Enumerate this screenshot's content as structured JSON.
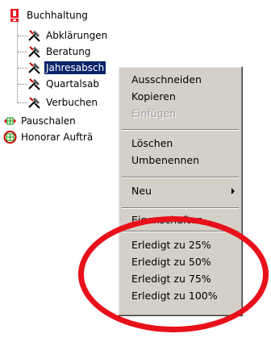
{
  "tree": {
    "root": {
      "label": "Buchhaltung",
      "icon": "exclamation-icon"
    },
    "children": [
      {
        "label": "Abklärungen",
        "icon": "tools-icon"
      },
      {
        "label": "Beratung",
        "icon": "tools-icon"
      },
      {
        "label": "Jahresabsch",
        "icon": "tools-icon",
        "selected": true
      },
      {
        "label": "Quartalsab",
        "icon": "tools-icon"
      },
      {
        "label": "Verbuchen",
        "icon": "tools-icon"
      }
    ],
    "siblings": [
      {
        "label": "Pauschalen",
        "icon": "grid-arrows-icon"
      },
      {
        "label": "Honorar Aufträ",
        "icon": "grid-cycle-icon"
      }
    ]
  },
  "context_menu": {
    "items": [
      {
        "label": "Ausschneiden"
      },
      {
        "label": "Kopieren"
      },
      {
        "label": "Einfügen",
        "disabled": true
      },
      {
        "label": "Löschen"
      },
      {
        "label": "Umbenennen"
      },
      {
        "label": "Neu",
        "submenu": true,
        "icon": "submenu-arrow-icon"
      },
      {
        "label": "Eigenschaften",
        "partially_hidden": true
      },
      {
        "label": "Erledigt zu 25%"
      },
      {
        "label": "Erledigt zu 50%"
      },
      {
        "label": "Erledigt zu 75%"
      },
      {
        "label": "Erledigt zu 100%"
      }
    ]
  },
  "colors": {
    "selection": "#0a246a",
    "menu_background": "#d4d0c8",
    "annotation_ring": "#e8101a",
    "exclamation_icon": "#e8101a",
    "tree_icon_red": "#cc0000",
    "tree_icon_green": "#009900"
  }
}
